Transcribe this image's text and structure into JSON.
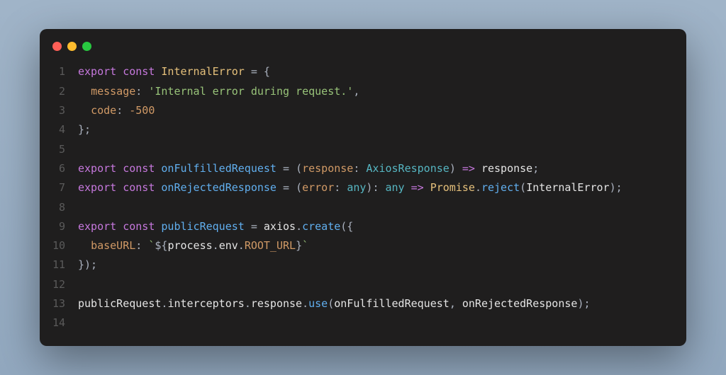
{
  "window": {
    "dots": [
      "red",
      "yellow",
      "green"
    ]
  },
  "code": {
    "gutter": [
      "1",
      "2",
      "3",
      "4",
      "5",
      "6",
      "7",
      "8",
      "9",
      "10",
      "11",
      "12",
      "13",
      "14"
    ],
    "tokens": {
      "l1": {
        "export": "export",
        "const": "const",
        "InternalError": "InternalError",
        "eq_brace": " = {"
      },
      "l2": {
        "indent": "  ",
        "message_key": "message",
        "colon_sp": ": ",
        "message_val": "'Internal error during request.'",
        "comma": ","
      },
      "l3": {
        "indent": "  ",
        "code_key": "code",
        "colon_sp": ": ",
        "code_val": "-500"
      },
      "l4": {
        "close": "};"
      },
      "l6": {
        "export": "export",
        "const": "const",
        "name": "onFulfilledRequest",
        "eq": " = ",
        "lp": "(",
        "param": "response",
        "colon_sp": ": ",
        "type": "AxiosResponse",
        "rp_arrow_sp": ") ",
        "arrow": "=>",
        "sp": " ",
        "ret": "response",
        "semi": ";"
      },
      "l7": {
        "export": "export",
        "const": "const",
        "name": "onRejectedResponse",
        "eq": " = ",
        "lp": "(",
        "param": "error",
        "colon_sp": ": ",
        "ptype": "any",
        "rp": ")",
        "colon2": ": ",
        "rtype": "any",
        "sp_arrow": " ",
        "arrow": "=>",
        "sp": " ",
        "Promise": "Promise",
        "dot": ".",
        "reject": "reject",
        "lp2": "(",
        "arg": "InternalError",
        "rp2_semi": ");"
      },
      "l9": {
        "export": "export",
        "const": "const",
        "name": "publicRequest",
        "eq": " = ",
        "axios": "axios",
        "dot": ".",
        "create": "create",
        "tail": "({"
      },
      "l10": {
        "indent": "  ",
        "key": "baseURL",
        "colon_sp": ": ",
        "bt1": "`",
        "dollar_brace": "${",
        "process": "process",
        "d1": ".",
        "env": "env",
        "d2": ".",
        "root": "ROOT_URL",
        "close_brace": "}",
        "bt2": "`"
      },
      "l11": {
        "close": "});"
      },
      "l13": {
        "publicRequest": "publicRequest",
        "d1": ".",
        "interceptors": "interceptors",
        "d2": ".",
        "response": "response",
        "d3": ".",
        "use": "use",
        "lp": "(",
        "a1": "onFulfilledRequest",
        "comma_sp": ", ",
        "a2": "onRejectedResponse",
        "rp_semi": ");"
      }
    }
  }
}
